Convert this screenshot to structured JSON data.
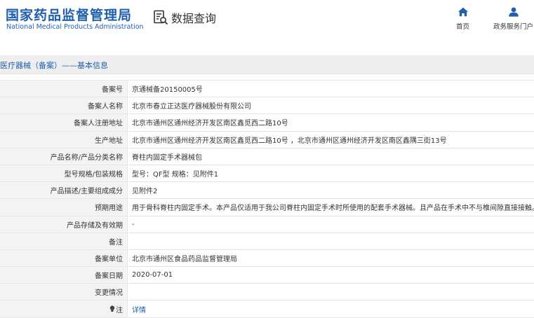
{
  "header": {
    "logo_cn": "国家药品监督管理局",
    "logo_en": "National Medical Products Administration",
    "query_label": "数据查询",
    "nav": [
      {
        "label": "首页",
        "icon": "home-icon"
      },
      {
        "label": "政务服务门户",
        "icon": "user-icon"
      }
    ]
  },
  "section": {
    "title": "医疗器械（备案）——基本信息"
  },
  "rows": [
    {
      "label": "备案号",
      "value": "京通械备20150005号"
    },
    {
      "label": "备案人名称",
      "value": "北京市春立正达医疗器械股份有限公司"
    },
    {
      "label": "备案人注册地址",
      "value": "北京市通州区通州经济开发区南区鑫觅西二路10号"
    },
    {
      "label": "生产地址",
      "value": "北京市通州区通州经济开发区南区鑫觅西二路10号 ，北京市通州区通州经济开发区南区鑫隅三街13号"
    },
    {
      "label": "产品名称/产品分类名称",
      "value": "脊柱内固定手术器械包"
    },
    {
      "label": "型号规格/包装规格",
      "value": "型号：QF型 规格：见附件1"
    },
    {
      "label": "产品描述/主要组成成分",
      "value": "见附件2"
    },
    {
      "label": "预期用途",
      "value": "用于骨科脊柱内固定手术。本产品仅适用于我公司脊柱内固定手术时所使用的配套手术器械。且产品在手术中不与椎间隙直接接触。"
    },
    {
      "label": "产品存储及有效期",
      "value": "-"
    },
    {
      "label": "备注",
      "value": ""
    },
    {
      "label": "备案单位",
      "value": "北京市通州区食品药品监督管理局"
    },
    {
      "label": "备案日期",
      "value": "2020-07-01"
    },
    {
      "label": "变更情况",
      "value": ""
    },
    {
      "label": "注",
      "value": "详情",
      "icon": "lightbulb-icon"
    }
  ],
  "colors": {
    "brand_blue": "#1f5fad",
    "label_bg": "#f3f3f3",
    "section_bg": "#eeeeee"
  }
}
